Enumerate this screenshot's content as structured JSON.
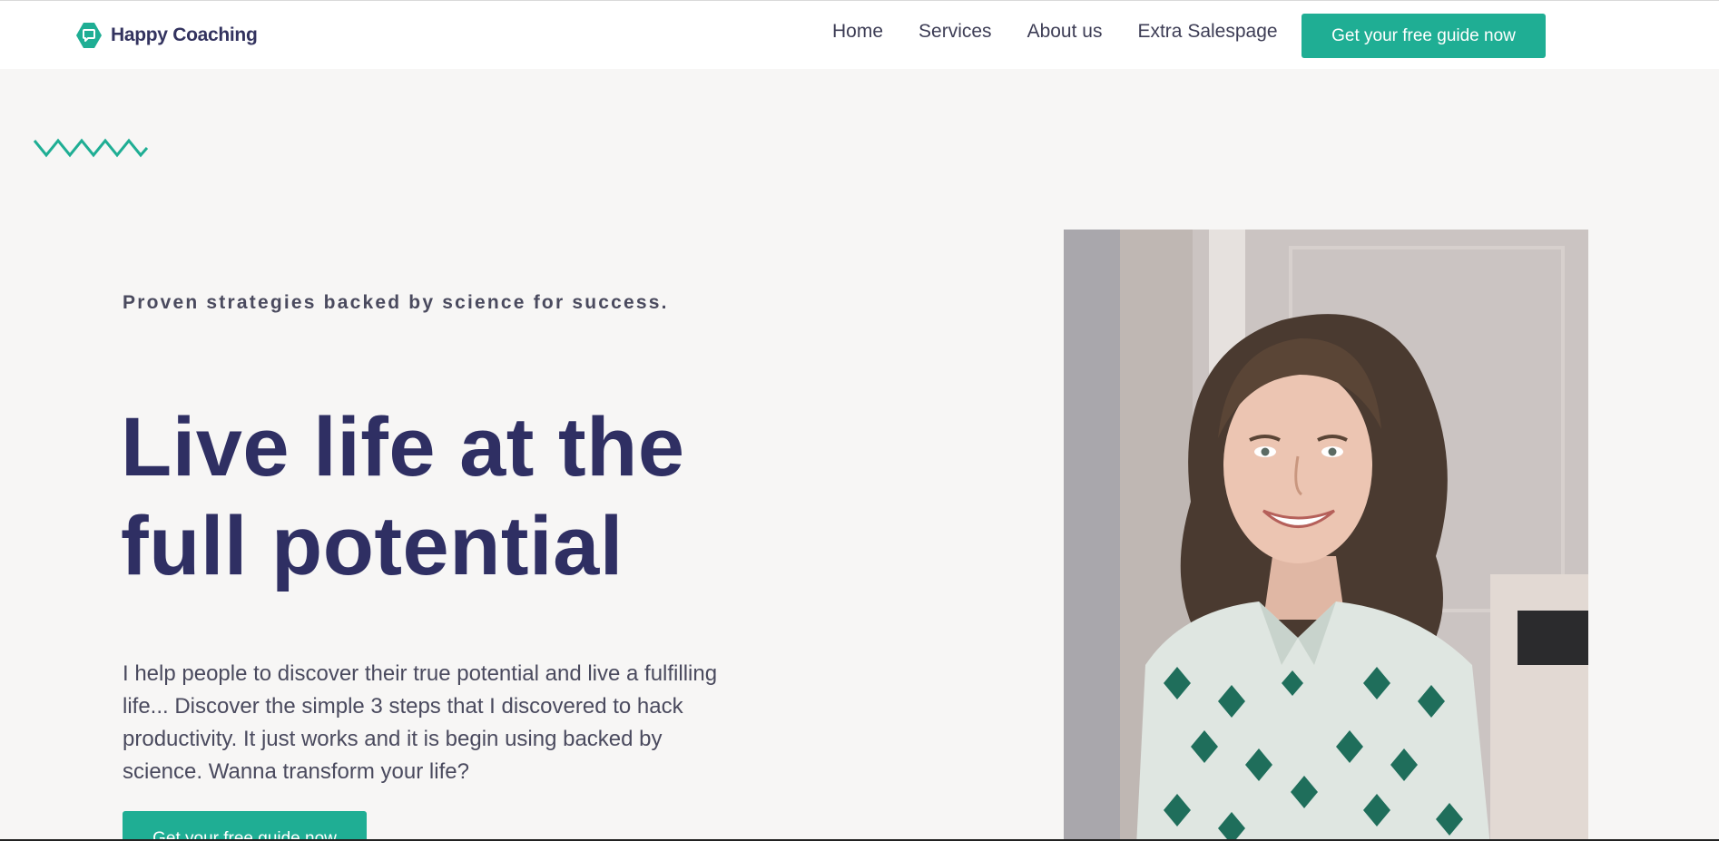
{
  "header": {
    "brand_name": "Happy Coaching",
    "brand_icon": "chat-bubble-hexagon-icon",
    "nav": [
      {
        "label": "Home"
      },
      {
        "label": "Services"
      },
      {
        "label": "About us"
      },
      {
        "label": "Extra Salespage"
      }
    ],
    "cta_label": "Get your free guide now"
  },
  "hero": {
    "tagline": "Proven strategies backed by science for success.",
    "headline": "Live life at the full potential",
    "intro": "I help people to discover their true potential and live a fulfilling life... Discover the simple 3 steps that I discovered to hack productivity. It just works and it is begin using backed by science. Wanna transform your life?",
    "cta_label": "Get your free guide now",
    "decoration_icon": "zigzag-icon",
    "image": "portrait-woman-smiling"
  },
  "colors": {
    "accent": "#1fae94",
    "headline": "#2f2f63",
    "body_text": "#4a4a5e",
    "background": "#f7f6f5"
  }
}
